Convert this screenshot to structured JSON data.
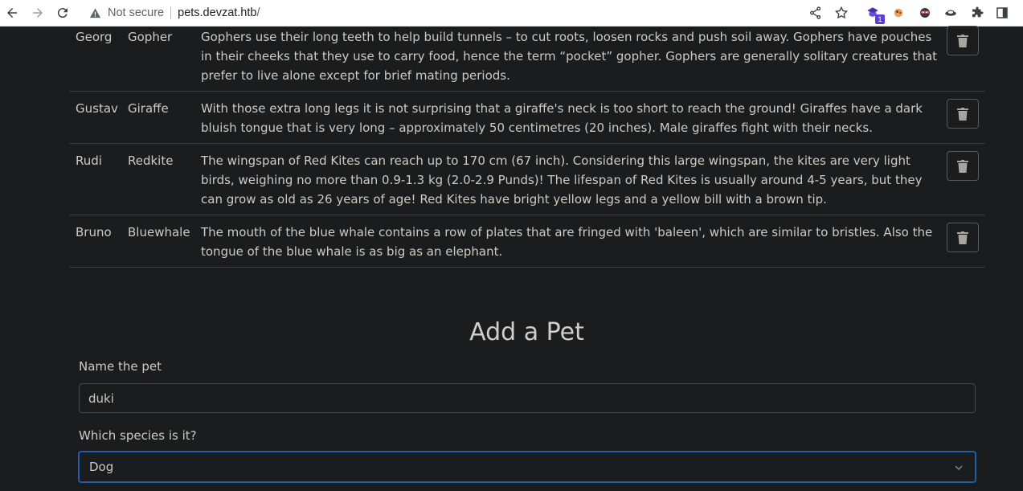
{
  "browser": {
    "security_label": "Not secure",
    "url_host": "pets.devzat.htb",
    "url_path": "/",
    "extension_badge": "1",
    "icons": [
      "back-icon",
      "forward-icon",
      "reload-icon",
      "warning-icon",
      "share-icon",
      "star-icon",
      "extension-icon",
      "puzzle-icon",
      "sidebar-icon"
    ]
  },
  "pets": [
    {
      "name": "Georg",
      "species": "Gopher",
      "description": "Gophers use their long teeth to help build tunnels – to cut roots, loosen rocks and push soil away. Gophers have pouches in their cheeks that they use to carry food, hence the term “pocket” gopher. Gophers are generally solitary creatures that prefer to live alone except for brief mating periods."
    },
    {
      "name": "Gustav",
      "species": "Giraffe",
      "description": "With those extra long legs it is not surprising that a giraffe's neck is too short to reach the ground! Giraffes have a dark bluish tongue that is very long – approximately 50 centimetres (20 inches). Male giraffes fight with their necks."
    },
    {
      "name": "Rudi",
      "species": "Redkite",
      "description": "The wingspan of Red Kites can reach up to 170 cm (67 inch). Considering this large wingspan, the kites are very light birds, weighing no more than 0.9-1.3 kg (2.0-2.9 Punds)! The lifespan of Red Kites is usually around 4-5 years, but they can grow as old as 26 years of age! Red Kites have bright yellow legs and a yellow bill with a brown tip."
    },
    {
      "name": "Bruno",
      "species": "Bluewhale",
      "description": "The mouth of the blue whale contains a row of plates that are fringed with 'baleen', which are similar to bristles. Also the tongue of the blue whale is as big as an elephant."
    }
  ],
  "form": {
    "title": "Add a Pet",
    "name_label": "Name the pet",
    "name_value": "duki",
    "species_label": "Which species is it?",
    "species_value": "Dog"
  },
  "colors": {
    "background": "#1b1c1e",
    "text": "#cfcac3",
    "border": "#3b3f42",
    "focus": "#1f5fa8"
  }
}
